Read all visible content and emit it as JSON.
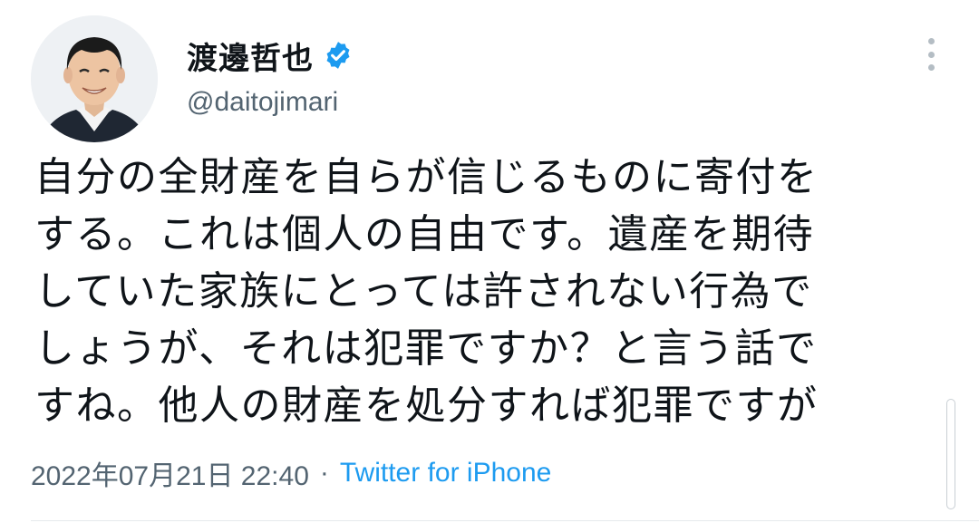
{
  "profile": {
    "display_name": "渡邊哲也",
    "handle": "@daitojimari",
    "verified": true,
    "avatar": "avatar-photo"
  },
  "tweet": {
    "lines": [
      "自分の全財産を自らが信じるものに寄付を",
      "する。これは個人の自由です。遺産を期待",
      "していた家族にとっては許されない行為で",
      "しょうが、それは犯罪ですか？と言う話で",
      "すね。他人の財産を処分すれば犯罪ですが"
    ]
  },
  "meta": {
    "timestamp": "2022年07月21日 22:40",
    "separator": "·",
    "source": "Twitter for iPhone"
  },
  "icons": {
    "verified": "verified-badge-icon",
    "more": "more-vertical-icon"
  },
  "colors": {
    "accent": "#1d9bf0",
    "text": "#0f1419",
    "secondary": "#536471"
  }
}
